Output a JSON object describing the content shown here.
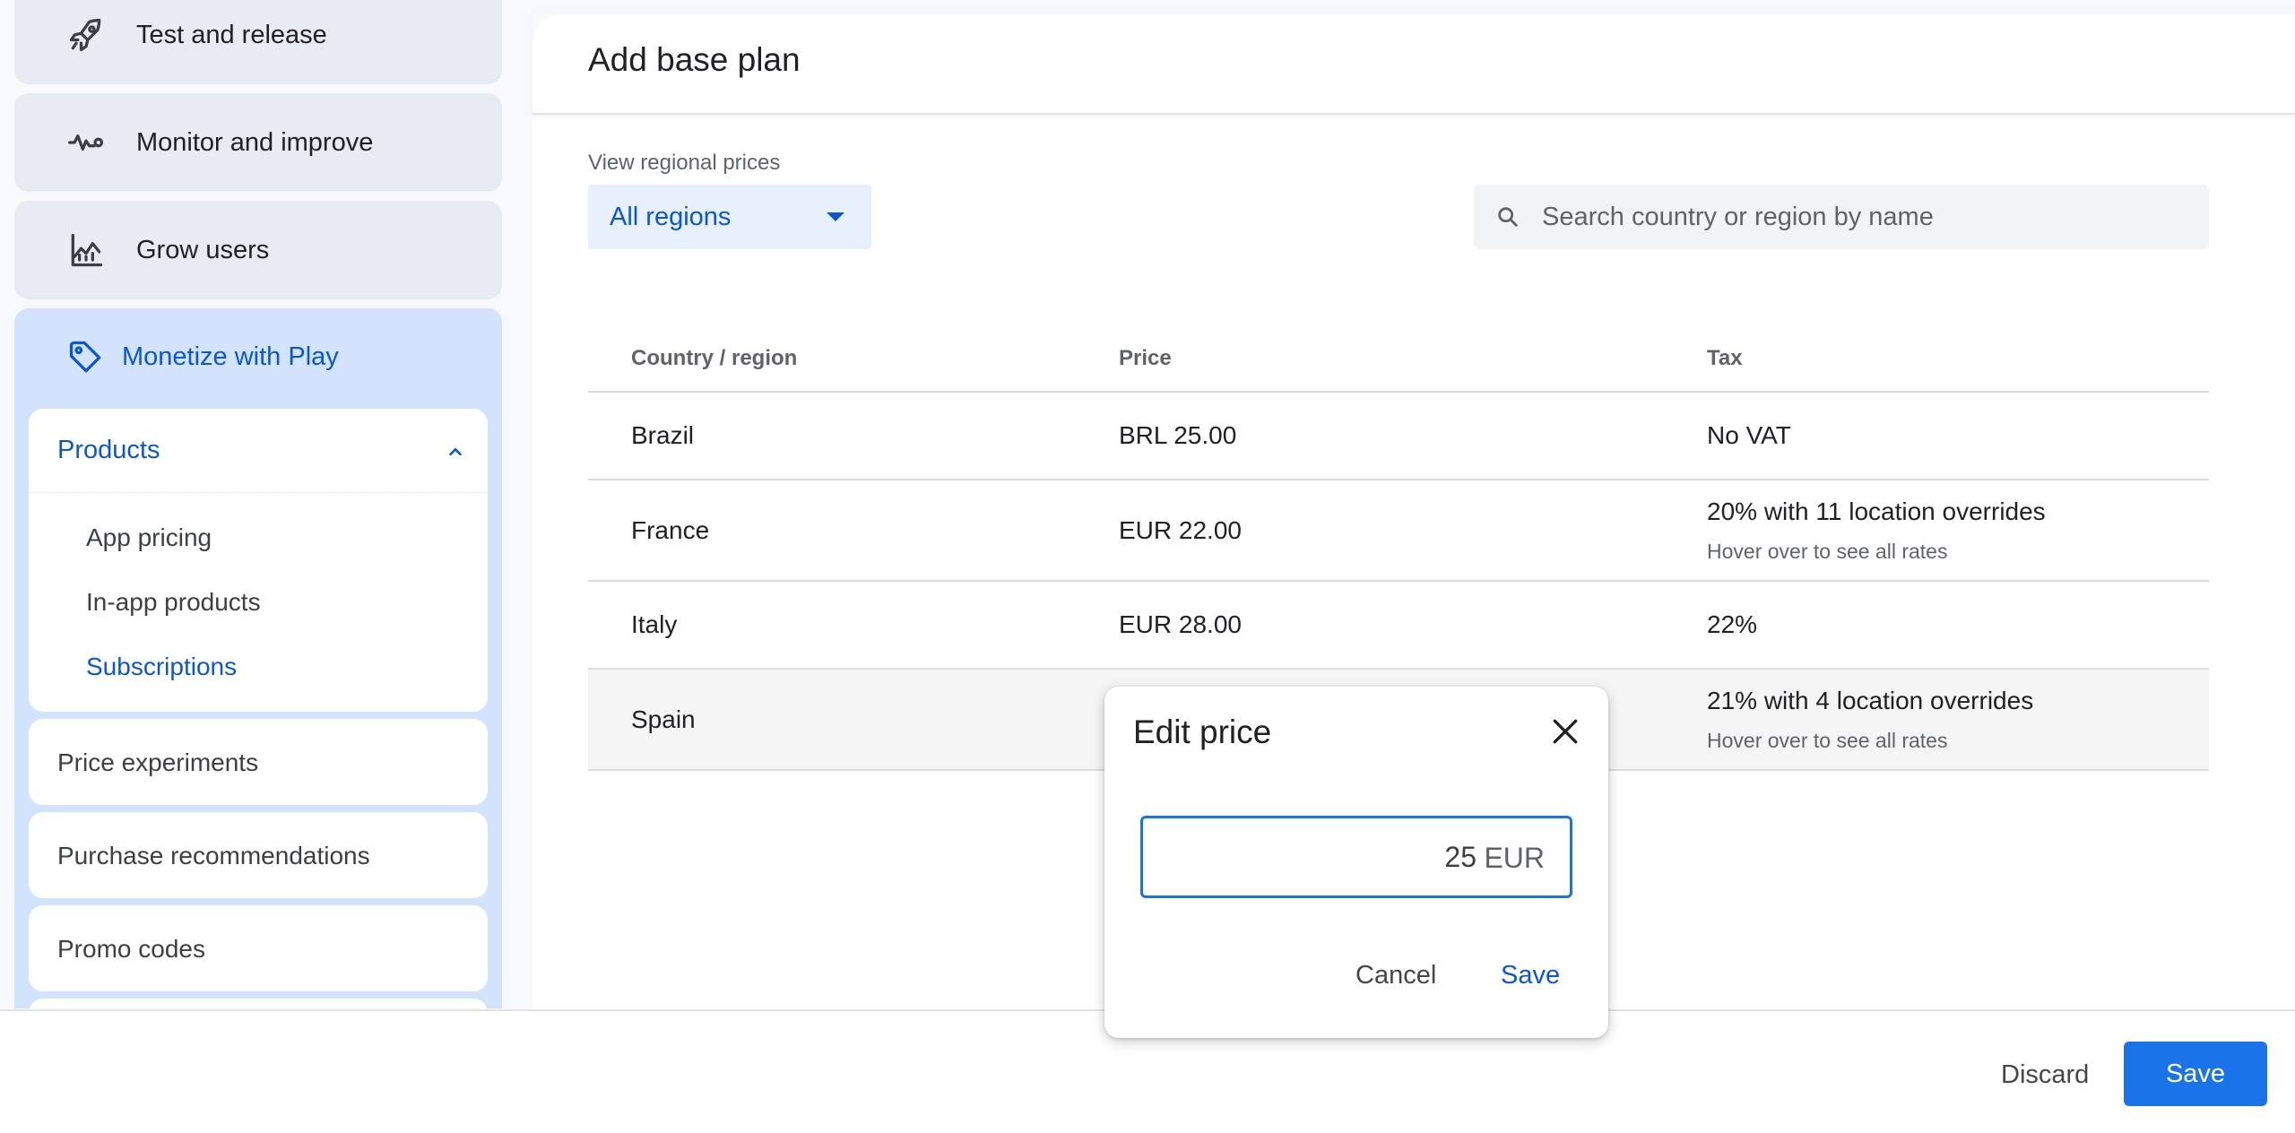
{
  "sidebar": {
    "items": [
      {
        "label": "Test and release",
        "icon": "rocket-icon"
      },
      {
        "label": "Monitor and improve",
        "icon": "vitals-icon"
      },
      {
        "label": "Grow users",
        "icon": "growth-chart-icon"
      }
    ],
    "monetize": {
      "label": "Monetize with Play",
      "icon": "tag-icon"
    },
    "products": {
      "label": "Products",
      "sub_items": [
        "App pricing",
        "In-app products",
        "Subscriptions"
      ],
      "active": "Subscriptions"
    },
    "cards": [
      "Price experiments",
      "Purchase recommendations",
      "Promo codes"
    ]
  },
  "main": {
    "title": "Add base plan",
    "region_label": "View regional prices",
    "region_select": "All regions",
    "search_placeholder": "Search country or region by name",
    "table": {
      "headers": [
        "Country / region",
        "Price",
        "Tax"
      ],
      "rows": [
        {
          "country": "Brazil",
          "price": "BRL 25.00",
          "tax": "No VAT",
          "tax_note": ""
        },
        {
          "country": "France",
          "price": "EUR 22.00",
          "tax": "20% with 11 location overrides",
          "tax_note": "Hover over to see all rates"
        },
        {
          "country": "Italy",
          "price": "EUR 28.00",
          "tax": "22%",
          "tax_note": ""
        },
        {
          "country": "Spain",
          "price": "",
          "tax": "21% with 4 location overrides",
          "tax_note": "Hover over to see all rates"
        }
      ]
    }
  },
  "dialog": {
    "title": "Edit price",
    "value": "25",
    "currency": "EUR",
    "cancel": "Cancel",
    "save": "Save"
  },
  "footer": {
    "discard": "Discard",
    "save": "Save"
  },
  "colors": {
    "accent": "#1a73e8",
    "active_text": "#0b57d0",
    "selected_bg": "#d3e3fd"
  }
}
